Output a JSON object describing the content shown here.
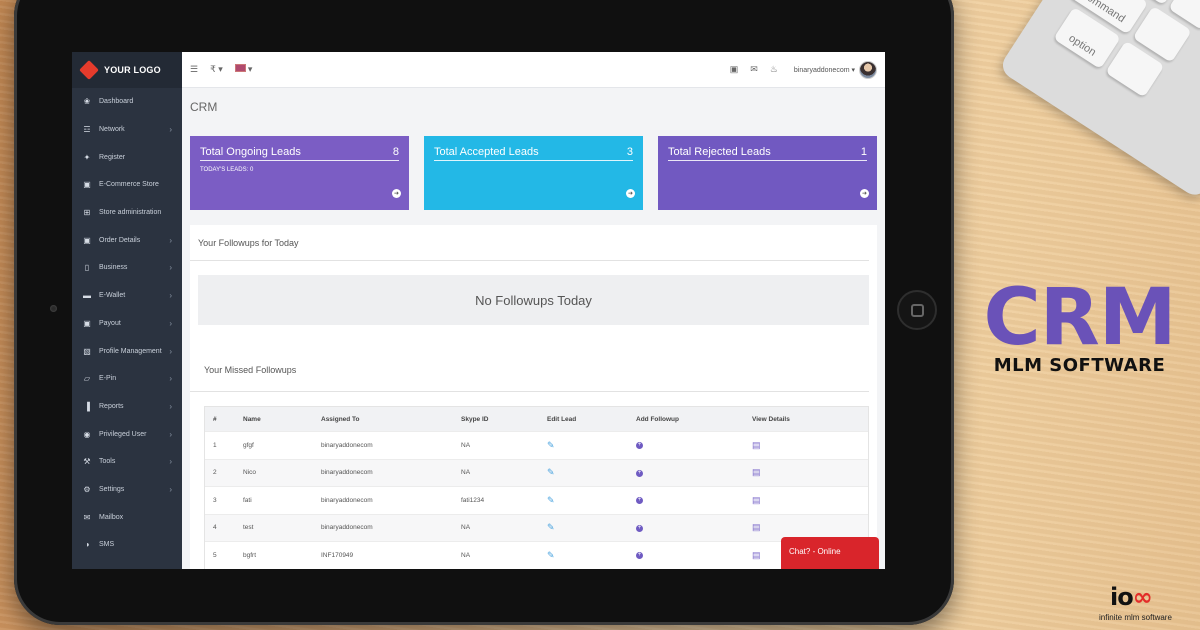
{
  "background": {
    "keyboard_keys": [
      "command",
      "option"
    ]
  },
  "app": {
    "logo_text": "YOUR LOGO",
    "sidebar": {
      "items": [
        {
          "label": "Dashboard",
          "icon": "palette-icon",
          "glyph": "❀",
          "has_children": false
        },
        {
          "label": "Network",
          "icon": "network-icon",
          "glyph": "☲",
          "has_children": true
        },
        {
          "label": "Register",
          "icon": "add-user-icon",
          "glyph": "✦",
          "has_children": false
        },
        {
          "label": "E-Commerce Store",
          "icon": "cart-icon",
          "glyph": "▣",
          "has_children": false
        },
        {
          "label": "Store administration",
          "icon": "cart-outline-icon",
          "glyph": "⊞",
          "has_children": false
        },
        {
          "label": "Order Details",
          "icon": "cart-icon",
          "glyph": "▣",
          "has_children": true
        },
        {
          "label": "Business",
          "icon": "document-icon",
          "glyph": "▯",
          "has_children": true
        },
        {
          "label": "E-Wallet",
          "icon": "wallet-icon",
          "glyph": "▬",
          "has_children": true
        },
        {
          "label": "Payout",
          "icon": "money-icon",
          "glyph": "▣",
          "has_children": true
        },
        {
          "label": "Profile Management",
          "icon": "profile-icon",
          "glyph": "▧",
          "has_children": true
        },
        {
          "label": "E-Pin",
          "icon": "bookmark-icon",
          "glyph": "▱",
          "has_children": true
        },
        {
          "label": "Reports",
          "icon": "bar-chart-icon",
          "glyph": "▐",
          "has_children": true
        },
        {
          "label": "Privileged User",
          "icon": "user-circle-icon",
          "glyph": "◉",
          "has_children": true
        },
        {
          "label": "Tools",
          "icon": "wrench-icon",
          "glyph": "⚒",
          "has_children": true
        },
        {
          "label": "Settings",
          "icon": "gear-icon",
          "glyph": "⚙",
          "has_children": true
        },
        {
          "label": "Mailbox",
          "icon": "mail-icon",
          "glyph": "✉",
          "has_children": false
        },
        {
          "label": "SMS",
          "icon": "chat-icon",
          "glyph": "◑",
          "has_children": false
        }
      ]
    },
    "topbar": {
      "user_name": "binaryaddonecom ▾",
      "lang_caret": "▾",
      "currency_label": "₹ ▾"
    },
    "page_title": "CRM",
    "cards": [
      {
        "title": "Total Ongoing Leads",
        "count": "8",
        "sub": "TODAY'S LEADS: 0",
        "color": "#7b5dc4"
      },
      {
        "title": "Total Accepted Leads",
        "count": "3",
        "sub": "",
        "color": "#23b8e6"
      },
      {
        "title": "Total Rejected Leads",
        "count": "1",
        "sub": "",
        "color": "#7159c1"
      }
    ],
    "followups": {
      "heading": "Your Followups for Today",
      "empty_text": "No Followups Today"
    },
    "missed": {
      "heading": "Your Missed Followups",
      "columns": [
        "#",
        "Name",
        "Assigned To",
        "Skype ID",
        "Edit Lead",
        "Add Followup",
        "View Details"
      ],
      "rows": [
        {
          "n": "1",
          "name": "gfgf",
          "assigned": "binaryaddonecom",
          "skype": "NA"
        },
        {
          "n": "2",
          "name": "Nico",
          "assigned": "binaryaddonecom",
          "skype": "NA"
        },
        {
          "n": "3",
          "name": "fati",
          "assigned": "binaryaddonecom",
          "skype": "fati1234"
        },
        {
          "n": "4",
          "name": "test",
          "assigned": "binaryaddonecom",
          "skype": "NA"
        },
        {
          "n": "5",
          "name": "bgfrt",
          "assigned": "INF170949",
          "skype": "NA"
        }
      ]
    },
    "chat_label": "Chat? - Online"
  },
  "branding": {
    "headline": "CRM",
    "subline": "MLM SOFTWARE",
    "company_logo": "ioss",
    "tagline": "infinite mlm software",
    "accent_color": "#6a52b8"
  }
}
